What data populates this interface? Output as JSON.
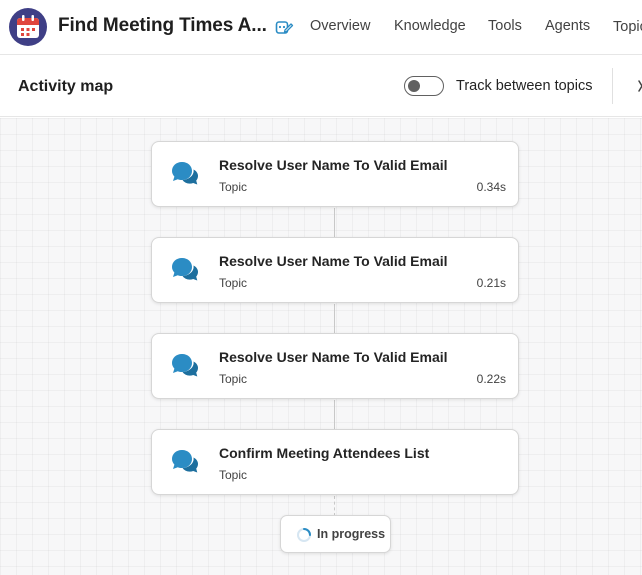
{
  "header": {
    "app_icon": "calendar-icon",
    "app_title": "Find Meeting Times A...",
    "edit_icon": "edit-agent-icon",
    "nav": [
      "Overview",
      "Knowledge",
      "Tools",
      "Agents",
      "Topics"
    ]
  },
  "panel": {
    "title": "Activity map",
    "toggle_label": "Track between topics",
    "toggle_on": false,
    "close_icon": "close-icon"
  },
  "activity": {
    "items": [
      {
        "title": "Resolve User Name To Valid Email",
        "type": "Topic",
        "duration": "0.34s",
        "icon": "topic-chat-icon"
      },
      {
        "title": "Resolve User Name To Valid Email",
        "type": "Topic",
        "duration": "0.21s",
        "icon": "topic-chat-icon"
      },
      {
        "title": "Resolve User Name To Valid Email",
        "type": "Topic",
        "duration": "0.22s",
        "icon": "topic-chat-icon"
      },
      {
        "title": "Confirm Meeting Attendees List",
        "type": "Topic",
        "duration": "",
        "icon": "topic-chat-icon"
      }
    ],
    "status_label": "In progress"
  },
  "colors": {
    "accent": "#2b8cc4",
    "app_icon_bg": "#3f3f86",
    "app_icon_red": "#e0463e"
  }
}
